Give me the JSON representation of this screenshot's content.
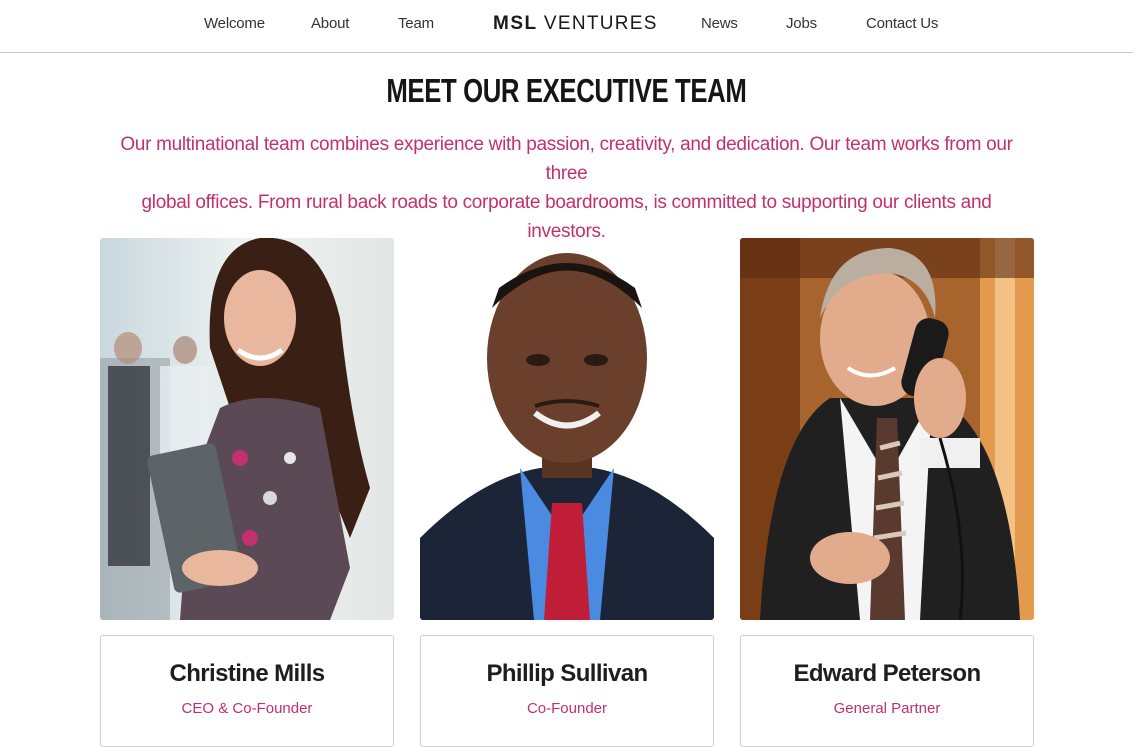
{
  "nav": {
    "left": [
      {
        "label": "Welcome"
      },
      {
        "label": "About"
      },
      {
        "label": "Team"
      }
    ],
    "logo": {
      "bold": "MSL",
      "light": "VENTURES"
    },
    "right": [
      {
        "label": "News"
      },
      {
        "label": "Jobs"
      },
      {
        "label": "Contact Us"
      }
    ]
  },
  "main": {
    "title": "MEET OUR EXECUTIVE TEAM",
    "intro_line1": "Our multinational team combines experience with passion, creativity, and dedication. Our team works from our three",
    "intro_line2": "global offices. From rural back roads to corporate boardrooms, is committed to supporting our clients and investors."
  },
  "team": [
    {
      "name": "Christine Mills",
      "role": "CEO & Co-Founder"
    },
    {
      "name": "Phillip Sullivan",
      "role": "Co-Founder"
    },
    {
      "name": "Edward Peterson",
      "role": "General Partner"
    }
  ],
  "colors": {
    "accent": "#c2306f",
    "text": "#1a1a1a"
  }
}
